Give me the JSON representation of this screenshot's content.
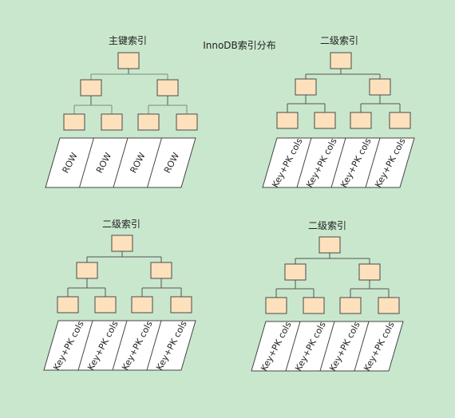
{
  "title": "InnoDB索引分布",
  "trees": [
    {
      "label": "主键索引",
      "leaf_label": "ROW"
    },
    {
      "label": "二级索引",
      "leaf_label": "Key+PK cols"
    },
    {
      "label": "二级索引",
      "leaf_label": "Key+PK cols"
    },
    {
      "label": "二级索引",
      "leaf_label": "Key+PK cols"
    }
  ],
  "colors": {
    "background": "#c9e7cd",
    "node_fill": "#fde1bc",
    "node_border": "#4a4a4a",
    "row_fill": "#ffffff"
  }
}
